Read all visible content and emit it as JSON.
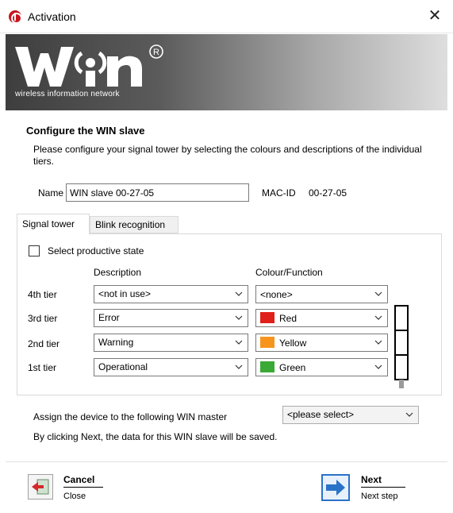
{
  "window": {
    "title": "Activation",
    "close_glyph": "✕"
  },
  "banner": {
    "logo_text": "WIN",
    "registered_mark": "®",
    "tagline": "wireless information network"
  },
  "section": {
    "title": "Configure the WIN slave",
    "description": "Please configure your signal tower by selecting the colours and descriptions of the individual tiers."
  },
  "device": {
    "name_label": "Name",
    "name_value": "WIN slave 00-27-05",
    "mac_label": "MAC-ID",
    "mac_value": "00-27-05"
  },
  "tabs": [
    {
      "label": "Signal tower",
      "active": true
    },
    {
      "label": "Blink recognition",
      "active": false
    }
  ],
  "signal_tower": {
    "checkbox_label": "Select productive state",
    "checkbox_checked": false,
    "col_description": "Description",
    "col_colour": "Colour/Function",
    "tiers": [
      {
        "label": "4th tier",
        "description": "<not in use>",
        "colour": "<none>",
        "swatch": null
      },
      {
        "label": "3rd tier",
        "description": "Error",
        "colour": "Red",
        "swatch": "#e0201a"
      },
      {
        "label": "2nd tier",
        "description": "Warning",
        "colour": "Yellow",
        "swatch": "#f7941d"
      },
      {
        "label": "1st tier",
        "description": "Operational",
        "colour": "Green",
        "swatch": "#3aa935"
      }
    ]
  },
  "master": {
    "label": "Assign the device to the following WIN master",
    "selected": "<please select>"
  },
  "saved_note": "By clicking Next, the data for this WIN slave will be saved.",
  "footer": {
    "cancel_title": "Cancel",
    "cancel_sub": "Close",
    "next_title": "Next",
    "next_sub": "Next step"
  },
  "colors": {
    "accent": "#2a72c8",
    "brand_red": "#c8141e"
  }
}
